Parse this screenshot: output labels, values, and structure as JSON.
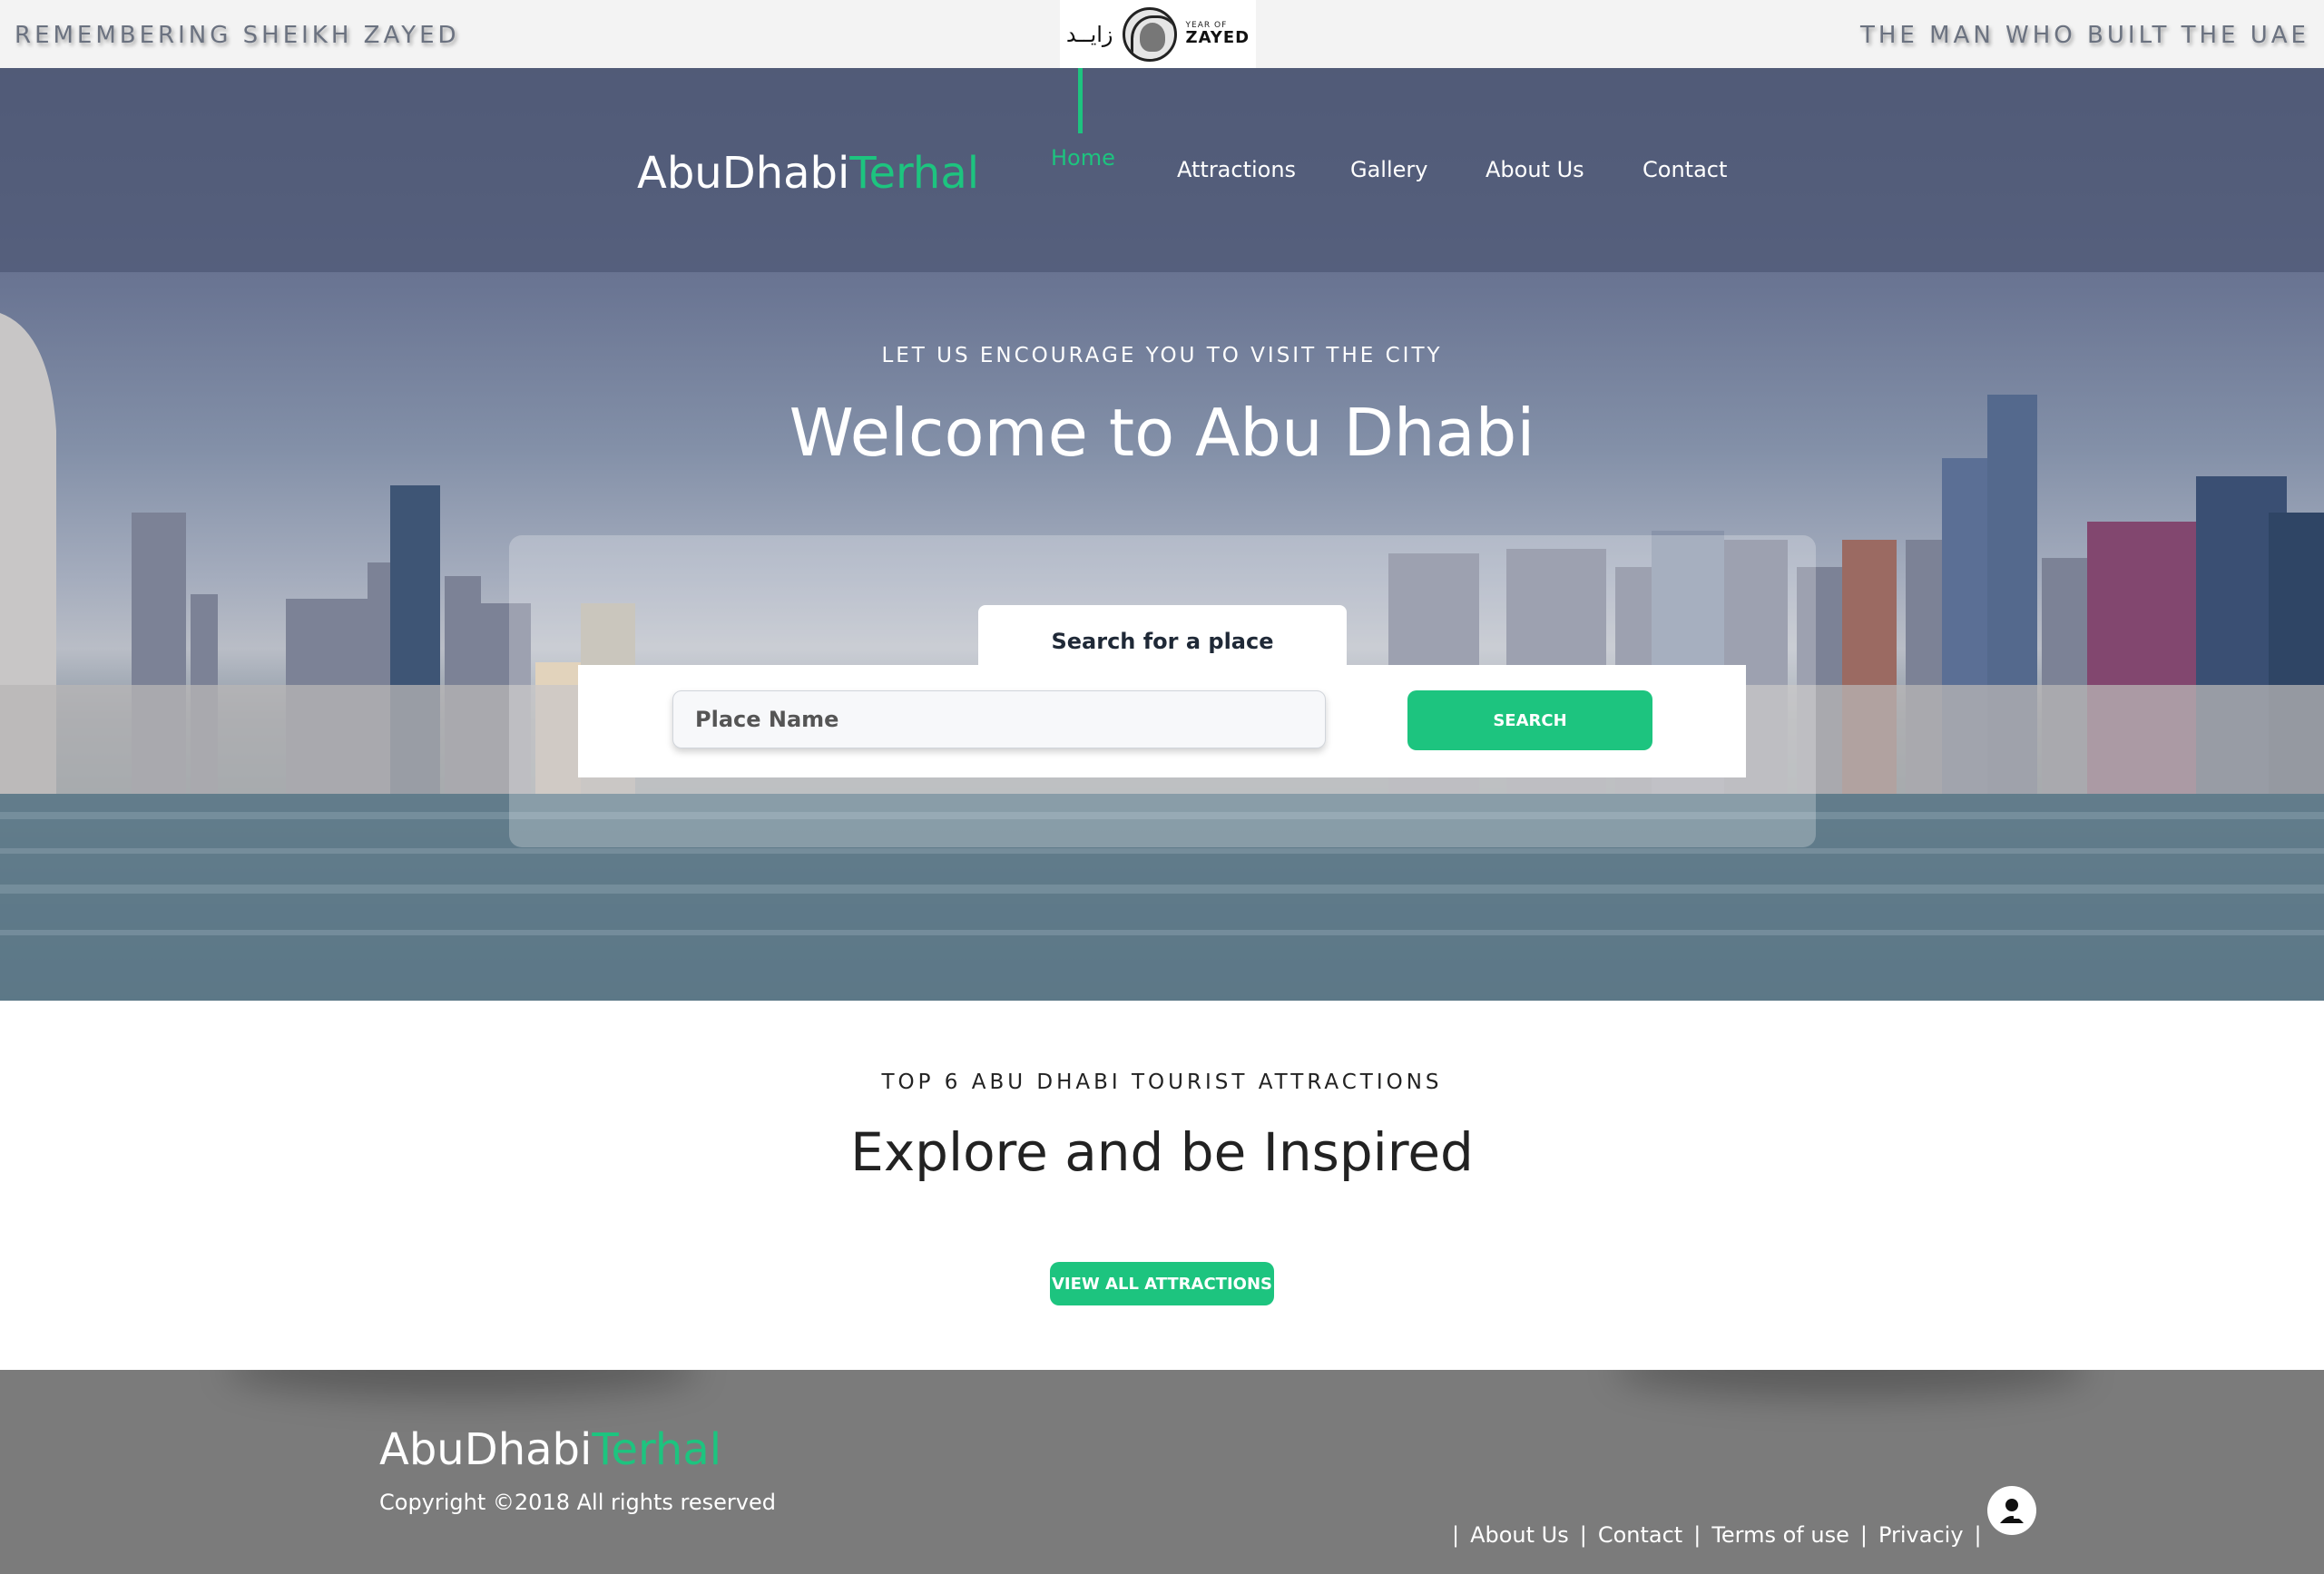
{
  "topbar": {
    "left_text": "REMEMBERING SHEIKH ZAYED",
    "right_text": "THE MAN WHO BUILT THE UAE",
    "logo": {
      "arabic": "زايــد",
      "small": "YEAR OF",
      "big": "ZAYED"
    }
  },
  "header": {
    "brand_main": "AbuDhabi",
    "brand_accent": "Terhal",
    "nav": [
      {
        "label": "Home",
        "active": true
      },
      {
        "label": "Attractions"
      },
      {
        "label": "Gallery"
      },
      {
        "label": "About Us"
      },
      {
        "label": "Contact"
      }
    ]
  },
  "hero": {
    "subtitle": "LET US ENCOURAGE YOU TO VISIT THE CITY",
    "title": "Welcome to Abu Dhabi",
    "search": {
      "tab_label": "Search for a place",
      "placeholder": "Place Name",
      "value": "",
      "button_label": "SEARCH"
    }
  },
  "explore": {
    "subtitle": "TOP 6 ABU DHABI TOURIST ATTRACTIONS",
    "title": "Explore and be Inspired",
    "button_label": "VIEW ALL ATTRACTIONS"
  },
  "footer": {
    "brand_main": "AbuDhabi",
    "brand_accent": "Terhal",
    "copyright": "Copyright ©2018 All rights reserved",
    "links": [
      "About Us",
      "Contact",
      "Terms of use",
      "Privaciy"
    ],
    "separator": "|"
  },
  "colors": {
    "accent": "#1dc47f",
    "footer_bg": "#7b7b7b",
    "topbar_bg": "#f3f3f3"
  },
  "icons": {
    "profile": "user-icon",
    "logo_portrait": "portrait-icon"
  }
}
